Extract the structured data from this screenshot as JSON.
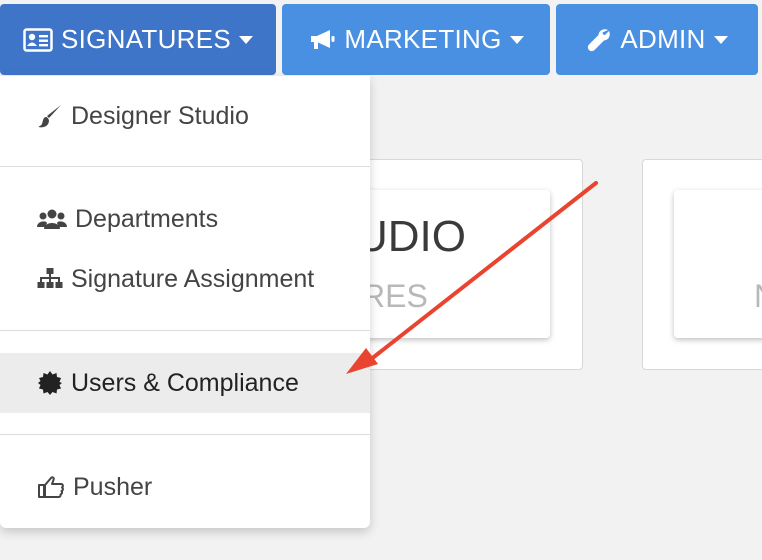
{
  "nav": {
    "signatures": {
      "label": "SIGNATURES",
      "icon": "id-card-icon"
    },
    "marketing": {
      "label": "MARKETING",
      "icon": "megaphone-icon"
    },
    "admin": {
      "label": "ADMIN",
      "icon": "wrench-icon"
    }
  },
  "colors": {
    "nav_button": "#4a90e2",
    "nav_button_active": "#3f75c8",
    "annotation_arrow": "#e8442f",
    "highlight_row": "#ececec"
  },
  "cards": [
    {
      "title": "UDIO",
      "subtitle": "RES"
    },
    {
      "title": "",
      "subtitle": "N"
    }
  ],
  "dropdown": {
    "items": [
      {
        "label": "Designer Studio",
        "icon": "paintbrush-icon"
      },
      {
        "label": "Departments",
        "icon": "users-icon"
      },
      {
        "label": "Signature Assignment",
        "icon": "sitemap-icon"
      },
      {
        "label": "Users & Compliance",
        "icon": "certificate-icon",
        "highlighted": true
      },
      {
        "label": "Pusher",
        "icon": "hand-pointer-icon"
      }
    ]
  }
}
